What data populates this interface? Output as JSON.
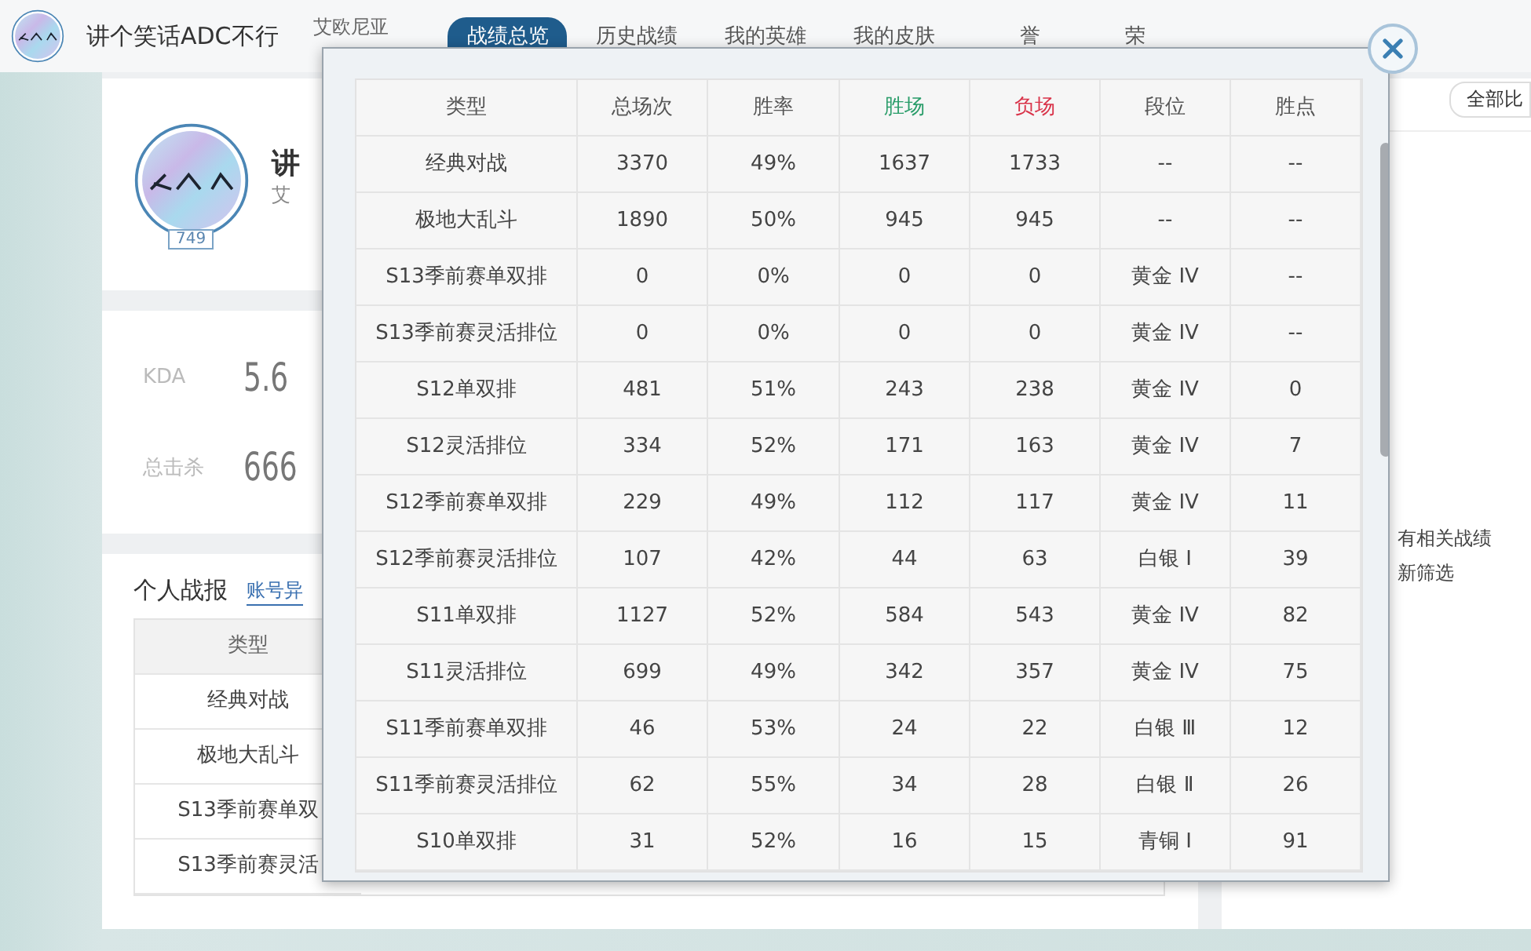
{
  "header": {
    "player_name": "讲个笑话ADC不行",
    "region": "艾欧尼亚",
    "nav": [
      {
        "label": "战绩总览",
        "selected": true
      },
      {
        "label": "历史战绩",
        "selected": false
      },
      {
        "label": "我的英雄",
        "selected": false
      },
      {
        "label": "我的皮肤",
        "selected": false
      },
      {
        "label": "誉",
        "selected": false
      },
      {
        "label": "荣",
        "selected": false
      }
    ]
  },
  "profile": {
    "name": "讲",
    "region": "艾",
    "level": "749"
  },
  "stats": [
    {
      "label": "KDA",
      "value": "5.6"
    },
    {
      "label": "总击杀",
      "value": "666"
    }
  ],
  "personal_report": {
    "title": "个人战报",
    "link": "账号异",
    "column": "类型",
    "rows": [
      "经典对战",
      "极地大乱斗",
      "S13季前赛单双",
      "S13季前赛灵活"
    ]
  },
  "right_panel": {
    "filter": "全部比",
    "empty_lines": [
      "有相关战绩",
      "新筛选"
    ]
  },
  "modal": {
    "columns": [
      {
        "label": "类型",
        "color": "#555555"
      },
      {
        "label": "总场次",
        "color": "#555555"
      },
      {
        "label": "胜率",
        "color": "#555555"
      },
      {
        "label": "胜场",
        "color": "#2a9d6a"
      },
      {
        "label": "负场",
        "color": "#d9344a"
      },
      {
        "label": "段位",
        "color": "#555555"
      },
      {
        "label": "胜点",
        "color": "#555555"
      }
    ],
    "rows": [
      [
        "经典对战",
        "3370",
        "49%",
        "1637",
        "1733",
        "--",
        "--"
      ],
      [
        "极地大乱斗",
        "1890",
        "50%",
        "945",
        "945",
        "--",
        "--"
      ],
      [
        "S13季前赛单双排",
        "0",
        "0%",
        "0",
        "0",
        "黄金 IV",
        "--"
      ],
      [
        "S13季前赛灵活排位",
        "0",
        "0%",
        "0",
        "0",
        "黄金 IV",
        "--"
      ],
      [
        "S12单双排",
        "481",
        "51%",
        "243",
        "238",
        "黄金 IV",
        "0"
      ],
      [
        "S12灵活排位",
        "334",
        "52%",
        "171",
        "163",
        "黄金 IV",
        "7"
      ],
      [
        "S12季前赛单双排",
        "229",
        "49%",
        "112",
        "117",
        "黄金 IV",
        "11"
      ],
      [
        "S12季前赛灵活排位",
        "107",
        "42%",
        "44",
        "63",
        "白银 Ⅰ",
        "39"
      ],
      [
        "S11单双排",
        "1127",
        "52%",
        "584",
        "543",
        "黄金 IV",
        "82"
      ],
      [
        "S11灵活排位",
        "699",
        "49%",
        "342",
        "357",
        "黄金 IV",
        "75"
      ],
      [
        "S11季前赛单双排",
        "46",
        "53%",
        "24",
        "22",
        "白银 Ⅲ",
        "12"
      ],
      [
        "S11季前赛灵活排位",
        "62",
        "55%",
        "34",
        "28",
        "白银 Ⅱ",
        "26"
      ],
      [
        "S10单双排",
        "31",
        "52%",
        "16",
        "15",
        "青铜 Ⅰ",
        "91"
      ]
    ]
  }
}
